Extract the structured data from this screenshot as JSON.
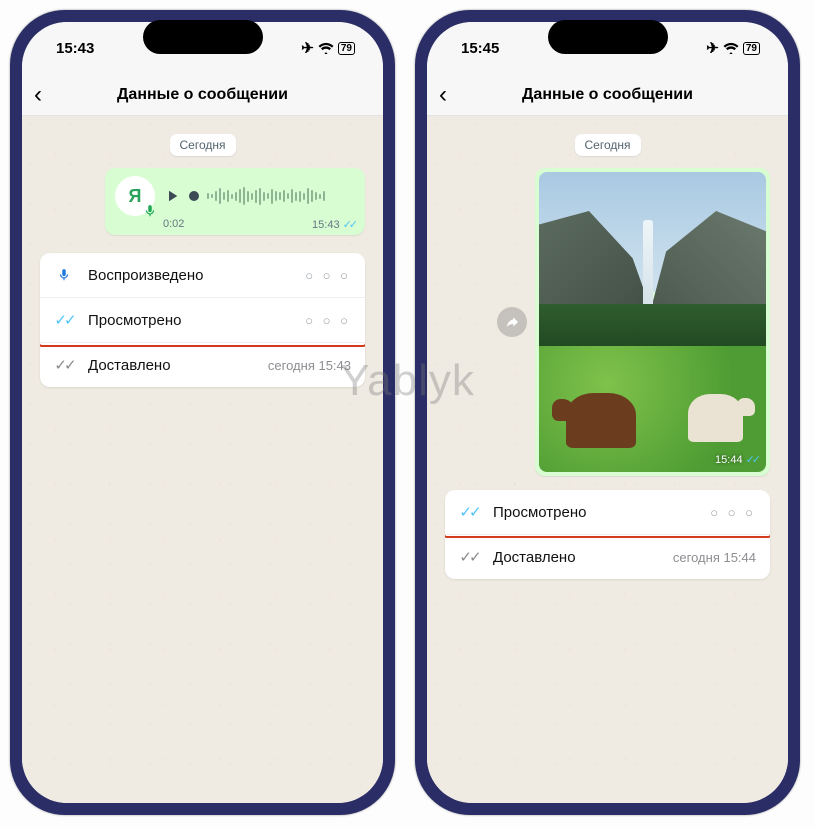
{
  "watermark": "Yablyk",
  "phone1": {
    "status": {
      "time": "15:43",
      "battery": "79"
    },
    "header": {
      "title": "Данные о сообщении"
    },
    "date_chip": "Сегодня",
    "voice": {
      "avatar_letter": "Я",
      "duration": "0:02",
      "timestamp": "15:43"
    },
    "rows": [
      {
        "icon": "mic-blue",
        "label": "Воспроизведено",
        "right_dots": "○ ○ ○"
      },
      {
        "icon": "ticks-blue",
        "label": "Просмотрено",
        "right_dots": "○ ○ ○"
      },
      {
        "icon": "ticks-gray",
        "label": "Доставлено",
        "right_time": "сегодня 15:43"
      }
    ]
  },
  "phone2": {
    "status": {
      "time": "15:45",
      "battery": "79"
    },
    "header": {
      "title": "Данные о сообщении"
    },
    "date_chip": "Сегодня",
    "photo": {
      "timestamp": "15:44"
    },
    "rows": [
      {
        "icon": "ticks-blue",
        "label": "Просмотрено",
        "right_dots": "○ ○ ○"
      },
      {
        "icon": "ticks-gray",
        "label": "Доставлено",
        "right_time": "сегодня 15:44"
      }
    ]
  }
}
